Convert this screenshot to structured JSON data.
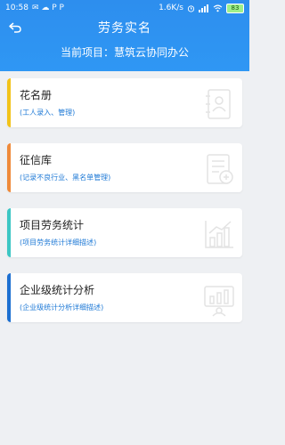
{
  "status": {
    "time": "10:58",
    "notifications": "✉ ☁ P P",
    "speed": "1.6K/s",
    "battery": "83"
  },
  "header": {
    "title": "劳务实名",
    "project_line": "当前项目：慧筑云协同办公"
  },
  "cards": [
    {
      "title": "花名册",
      "desc": "(工人录入、管理)",
      "accent": "#f2c31a",
      "icon": "roster-book-icon"
    },
    {
      "title": "征信库",
      "desc": "(记录不良行业、黑名单管理)",
      "accent": "#ef8a3a",
      "icon": "credit-document-icon"
    },
    {
      "title": "项目劳务统计",
      "desc": "(项目劳务统计详细描述)",
      "accent": "#3cc6c4",
      "icon": "statistics-chart-icon"
    },
    {
      "title": "企业级统计分析",
      "desc": "(企业级统计分析详细描述)",
      "accent": "#1c6fd1",
      "icon": "enterprise-analysis-icon"
    }
  ]
}
